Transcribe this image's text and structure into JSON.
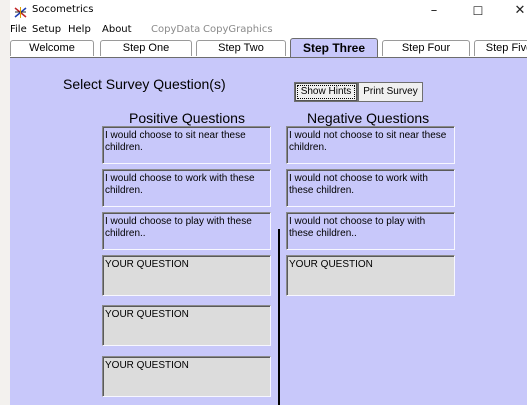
{
  "window": {
    "title": "Socometrics",
    "controls": {
      "minimize": "–",
      "maximize": "☐",
      "close": "✕"
    }
  },
  "menu": {
    "items": [
      {
        "label": "File",
        "enabled": true
      },
      {
        "label": "Setup",
        "enabled": true
      },
      {
        "label": "Help",
        "enabled": true
      },
      {
        "label": "About",
        "enabled": true
      },
      {
        "label": "CopyData",
        "enabled": false
      },
      {
        "label": "CopyGraphics",
        "enabled": false
      }
    ]
  },
  "tabs": [
    {
      "label": "Welcome",
      "active": false
    },
    {
      "label": "Step One",
      "active": false
    },
    {
      "label": "Step Two",
      "active": false
    },
    {
      "label": "Step Three",
      "active": true
    },
    {
      "label": "Step Four",
      "active": false
    },
    {
      "label": "Step Five",
      "active": false
    }
  ],
  "panel": {
    "title": "Select  Survey Question(s)",
    "show_hints_label": "Show Hints",
    "print_survey_label": "Print Survey",
    "positive_heading": "Positive Questions",
    "negative_heading": "Negative Questions",
    "positive_questions": [
      "I would choose to sit near these children.",
      "I would choose to work with these children.",
      "I would choose to play with these children..",
      "YOUR QUESTION",
      "YOUR QUESTION",
      "YOUR QUESTION"
    ],
    "negative_questions": [
      "I would not choose to sit near these children.",
      "I would not choose to work with these children.",
      "I would not choose to play with these children..",
      "YOUR QUESTION"
    ]
  },
  "colors": {
    "panel_bg": "#c8c8fa",
    "custom_field_bg": "#dcdcdc"
  }
}
